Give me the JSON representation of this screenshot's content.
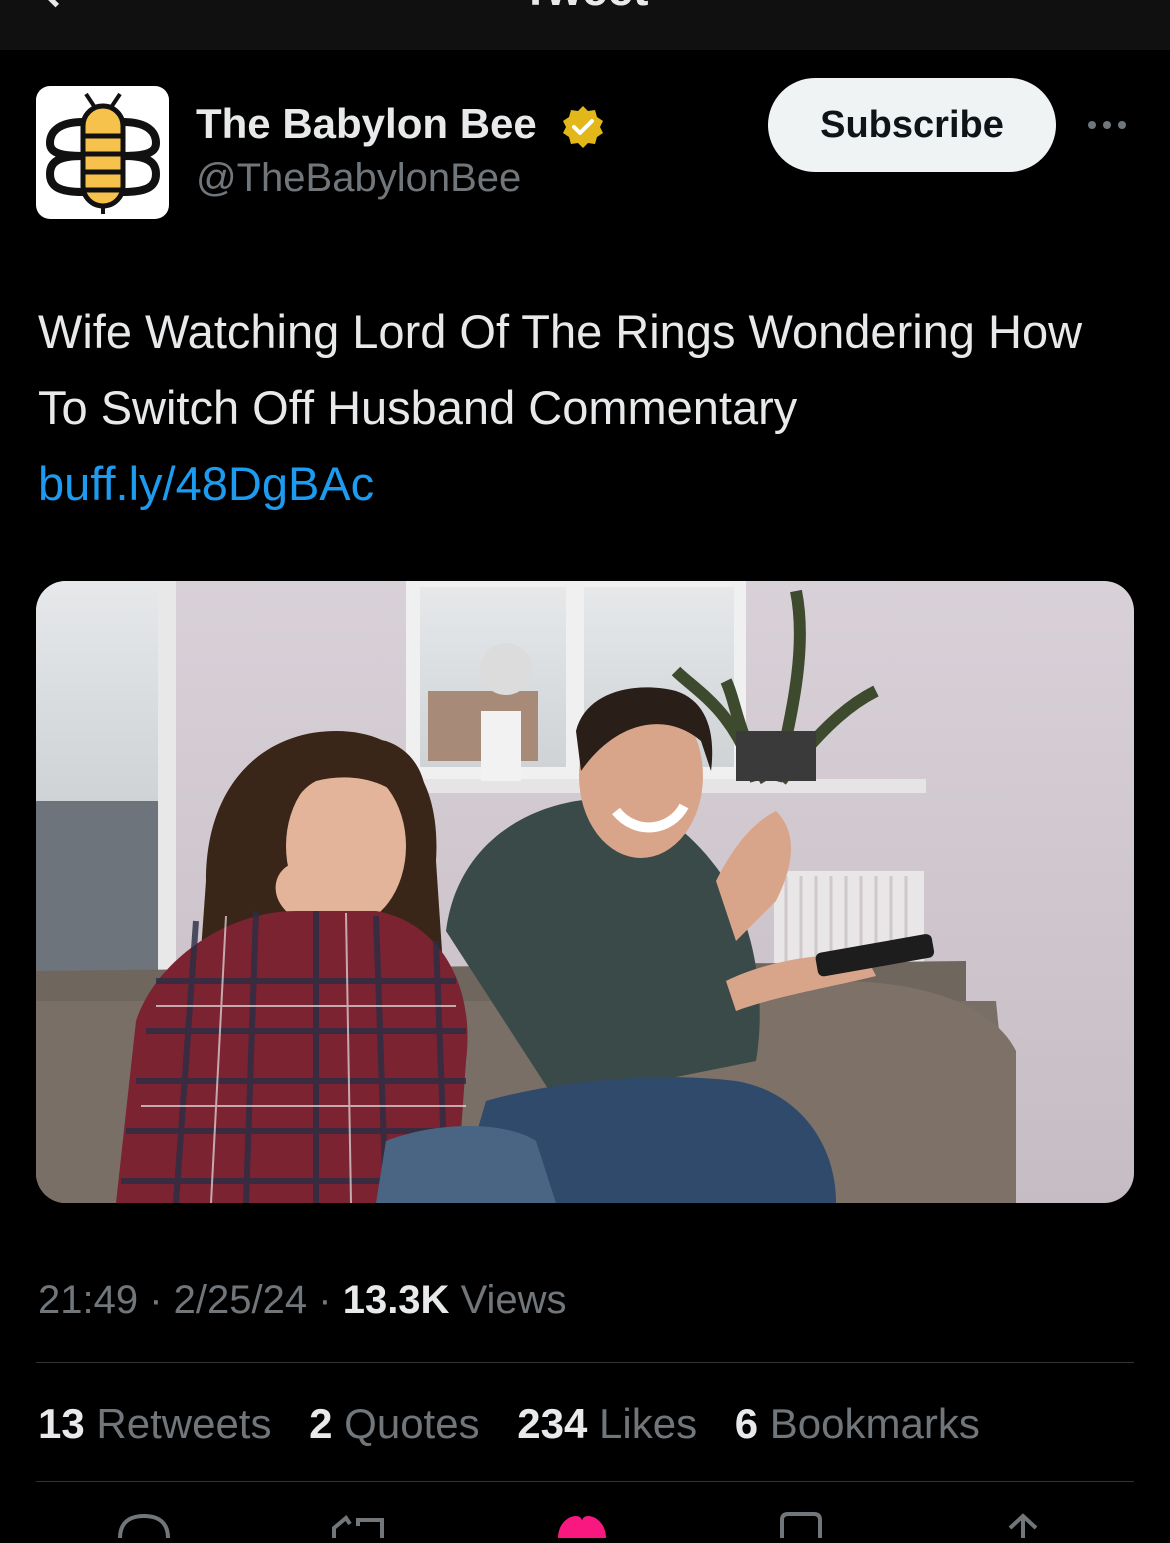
{
  "header": {
    "title": "Tweet"
  },
  "author": {
    "name": "The Babylon Bee",
    "handle": "@TheBabylonBee",
    "verified": true
  },
  "subscribe_label": "Subscribe",
  "tweet": {
    "text": "Wife Watching Lord Of The Rings Wondering How To Switch Off Husband Commentary",
    "link": "buff.ly/48DgBAc"
  },
  "meta": {
    "time": "21:49",
    "date": "2/25/24",
    "views_count": "13.3K",
    "views_label": "Views"
  },
  "stats": [
    {
      "count": "13",
      "label": "Retweets"
    },
    {
      "count": "2",
      "label": "Quotes"
    },
    {
      "count": "234",
      "label": "Likes"
    },
    {
      "count": "6",
      "label": "Bookmarks"
    }
  ],
  "colors": {
    "link": "#1d9bf0",
    "like": "#f91880",
    "verified": "#e2b719",
    "logo_yellow": "#f7c24b"
  },
  "icons": [
    "back-icon",
    "verified-badge-icon",
    "more-icon",
    "reply-icon",
    "retweet-icon",
    "like-icon",
    "bookmark-icon",
    "share-icon"
  ]
}
